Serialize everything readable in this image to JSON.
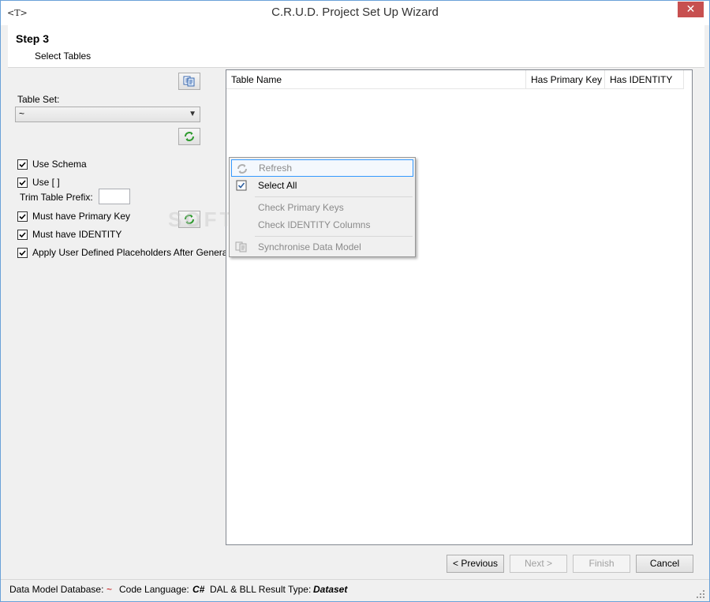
{
  "window": {
    "title": "C.R.U.D. Project Set Up Wizard",
    "app_icon": "<T>",
    "close_glyph": "✕"
  },
  "header": {
    "step": "Step 3",
    "subtitle": "Select Tables"
  },
  "left": {
    "table_set_label": "Table Set:",
    "table_set_value": "~",
    "trim_prefix_label": "Trim Table Prefix:",
    "trim_prefix_value": "",
    "options": [
      {
        "label": "Use Schema",
        "checked": true
      },
      {
        "label": "Use [ ]",
        "checked": true
      },
      {
        "label": "Must have Primary Key",
        "checked": true
      },
      {
        "label": "Must have IDENTITY",
        "checked": true
      },
      {
        "label": "Apply User Defined Placeholders After Generate",
        "checked": true
      }
    ]
  },
  "grid": {
    "columns": [
      "Table Name",
      "Has Primary Key",
      "Has IDENTITY"
    ]
  },
  "context_menu": {
    "items": [
      {
        "label": "Refresh",
        "enabled": false,
        "icon": "refresh-icon"
      },
      {
        "label": "Select All",
        "enabled": true,
        "icon": "checkbox-icon"
      },
      {
        "label": "Check Primary Keys",
        "enabled": false
      },
      {
        "label": "Check IDENTITY Columns",
        "enabled": false
      },
      {
        "label": "Synchronise Data Model",
        "enabled": false,
        "icon": "sync-model-icon"
      }
    ]
  },
  "buttons": {
    "previous": "< Previous",
    "next": "Next >",
    "finish": "Finish",
    "cancel": "Cancel"
  },
  "status": {
    "db_label": "Data Model Database:",
    "db_value": "~",
    "lang_label": "Code Language:",
    "lang_value": "C#",
    "result_label": "DAL & BLL Result Type:",
    "result_value": "Dataset"
  },
  "watermark": "SOFTPEDIA",
  "colors": {
    "accent": "#3399ff",
    "close": "#c75050",
    "refresh_green": "#2e9a2e",
    "status_red": "#c00000"
  }
}
